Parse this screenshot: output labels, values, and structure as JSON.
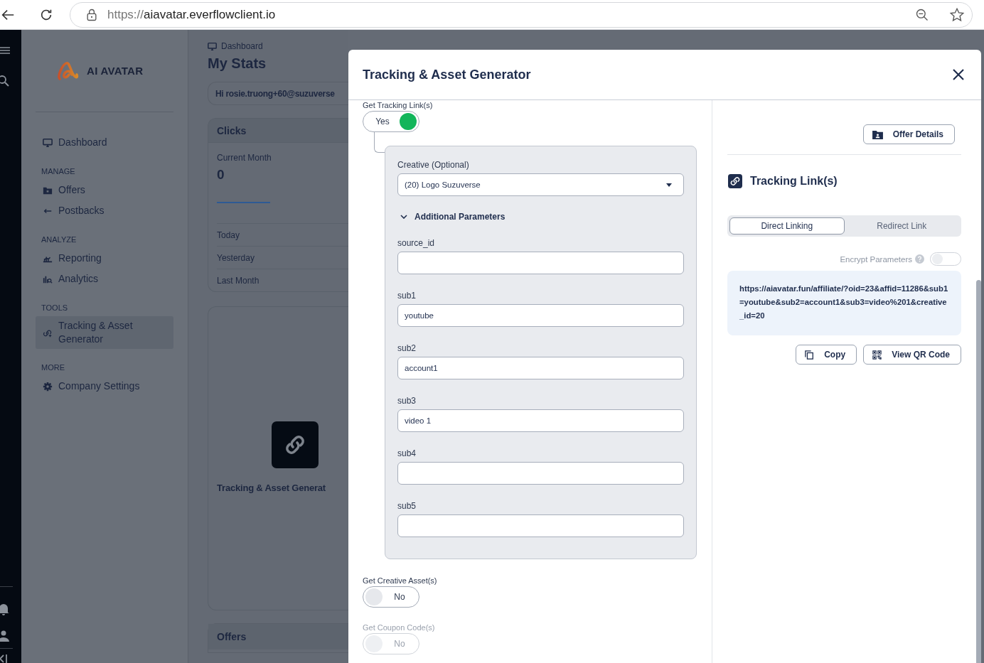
{
  "browser": {
    "url_scheme": "https://",
    "url_host": "aiavatar.everflowclient.io"
  },
  "sidebar": {
    "logo": "AI AVATAR",
    "sections": [
      {
        "items": [
          {
            "label": "Dashboard",
            "selected": false
          }
        ]
      },
      {
        "heading": "MANAGE",
        "items": [
          {
            "label": "Offers",
            "selected": false
          },
          {
            "label": "Postbacks",
            "selected": false
          }
        ]
      },
      {
        "heading": "ANALYZE",
        "items": [
          {
            "label": "Reporting",
            "selected": false
          },
          {
            "label": "Analytics",
            "selected": false
          }
        ]
      },
      {
        "heading": "TOOLS",
        "items": [
          {
            "label": "Tracking & Asset Generator",
            "selected": true
          }
        ]
      },
      {
        "heading": "MORE",
        "items": [
          {
            "label": "Company Settings",
            "selected": false
          }
        ]
      }
    ]
  },
  "main": {
    "breadcrumb": "Dashboard",
    "title": "My Stats",
    "greeting": "Hi rosie.truong+60@suzuverse",
    "clicks_card": {
      "title": "Clicks",
      "period": "Current Month",
      "value": "0",
      "rows": [
        "Today",
        "Yesterday",
        "Last Month"
      ]
    },
    "tool_card": {
      "title": "Tracking & Asset Generat"
    },
    "offers_card": {
      "title": "Offers"
    }
  },
  "modal": {
    "title": "Tracking & Asset Generator",
    "toggles": [
      {
        "label": "Get Tracking Link(s)",
        "value": "Yes",
        "on": true,
        "disabled": false
      },
      {
        "label": "Get Creative Asset(s)",
        "value": "No",
        "on": false,
        "disabled": false
      },
      {
        "label": "Get Coupon Code(s)",
        "value": "No",
        "on": false,
        "disabled": true
      }
    ],
    "creative": {
      "label": "Creative (Optional)",
      "value": "(20) Logo Suzuverse"
    },
    "additional_parameters": {
      "label": "Additional Parameters",
      "expanded": true,
      "fields": [
        {
          "label": "source_id"
        },
        {
          "label": "sub1",
          "value": "youtube"
        },
        {
          "label": "sub2",
          "value": "account1"
        },
        {
          "label": "sub3",
          "value": "video 1"
        },
        {
          "label": "sub4"
        },
        {
          "label": "sub5"
        }
      ]
    },
    "offer_details_button": "Offer Details",
    "links_heading": "Tracking Link(s)",
    "link_modes": [
      {
        "label": "Direct Linking",
        "selected": true
      },
      {
        "label": "Redirect Link",
        "selected": false
      }
    ],
    "encrypt": {
      "label": "Encrypt Parameters",
      "on": false
    },
    "link": "https://aiavatar.fun/affiliate/?oid=23&affid=11286&sub1=youtube&sub2=account1&sub3=video%201&creative_id=20",
    "actions": [
      "Copy",
      "View QR Code"
    ]
  }
}
